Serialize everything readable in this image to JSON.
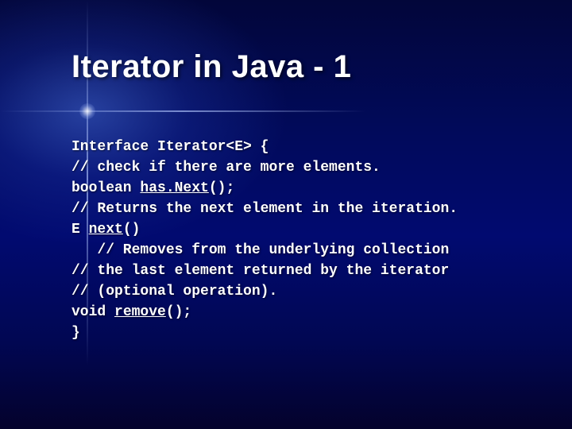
{
  "title": "Iterator in Java - 1",
  "code": {
    "l0a": "Interface Iterator<E> {",
    "l1": "// check if there are more elements.",
    "l2a": "boolean ",
    "l2b": "has.Next",
    "l2c": "();",
    "l3": "// Returns the next element in the iteration.",
    "l4a": "E ",
    "l4b": "next",
    "l4c": "()",
    "l5": "   // Removes from the underlying collection",
    "l6": "// the last element returned by the iterator",
    "l7": "// (optional operation).",
    "l8a": "void ",
    "l8b": "remove",
    "l8c": "();",
    "l9": "}"
  }
}
